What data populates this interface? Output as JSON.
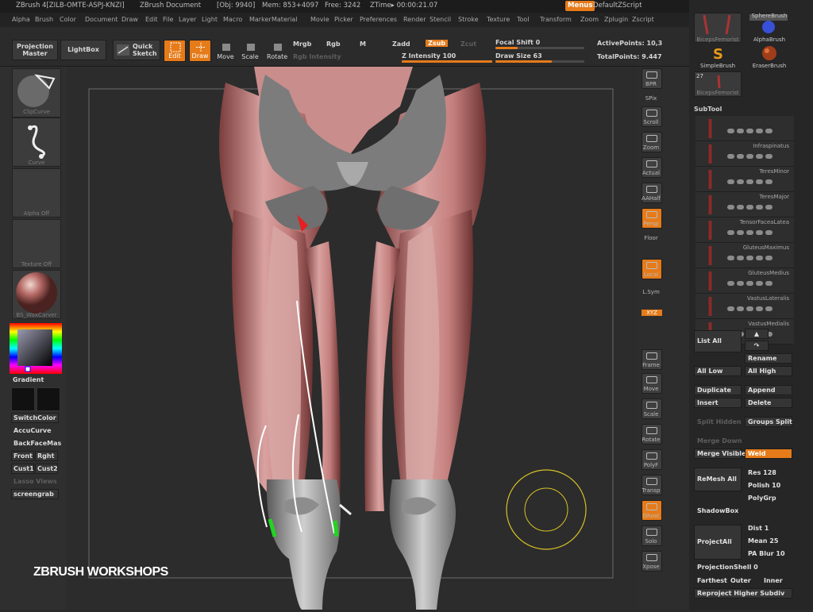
{
  "titlebar": {
    "app": "ZBrush 4[ZILB-OMTE-ASPJ-KNZI]",
    "doc": "ZBrush Document",
    "obj": "[Obj: 9940]",
    "mem": "Mem: 853+4097",
    "free": "Free: 3242",
    "ztime": "ZTime▸ 00:00:21.07",
    "menus_btn": "Menus",
    "script": "DefaultZScript"
  },
  "menubar": [
    "Alpha",
    "Brush",
    "Color",
    "Document",
    "Draw",
    "Edit",
    "File",
    "Layer",
    "Light",
    "Macro",
    "Marker",
    "Material",
    "Movie",
    "Picker",
    "Preferences",
    "Render",
    "Stencil",
    "Stroke",
    "Texture",
    "Tool",
    "Transform",
    "Zoom",
    "Zplugin",
    "Zscript"
  ],
  "toolbar": {
    "projection_master": "Projection Master",
    "lightbox": "LightBox",
    "quick_sketch": "Quick Sketch",
    "edit": "Edit",
    "draw": "Draw",
    "move": "Move",
    "scale": "Scale",
    "rotate": "Rotate",
    "mrgb": "Mrgb",
    "rgb": "Rgb",
    "m": "M",
    "rgb_intensity": "Rgb Intensity",
    "zadd": "Zadd",
    "zsub": "Zsub",
    "zcut": "Zcut",
    "z_intensity": "Z Intensity 100",
    "z_intensity_value": 100,
    "focal_shift": "Focal Shift 0",
    "focal_shift_value": 0,
    "draw_size": "Draw Size 63",
    "draw_size_value": 63,
    "active_points": "ActivePoints: 10,3",
    "total_points": "TotalPoints: 9.447"
  },
  "left": {
    "brush_name": "ClipCurve",
    "stroke_name": "Curve",
    "alpha_name": "Alpha  Off",
    "texture_name": "Texture  Off",
    "material_name": "BS_WaxCarver",
    "gradient": "Gradient",
    "switch_color": "SwitchColor",
    "accu_curve": "AccuCurve",
    "backface": "BackFaceMas",
    "front": "Front",
    "right": "Rght",
    "cust1": "Cust1",
    "cust2": "Cust2",
    "lasso_view": "Lasso Views",
    "screengrab": "screengrab"
  },
  "shelf": [
    "BPR",
    "SPix",
    "Scroll",
    "Zoom",
    "Actual",
    "AAHalf",
    "Persp",
    "Floor",
    "Local",
    "L.Sym",
    "XYZ",
    "Frame",
    "Move",
    "Scale",
    "Rotate",
    "PolyF",
    "Transp",
    "Ghost",
    "Solo",
    "Xpose"
  ],
  "right": {
    "brushes": [
      {
        "name": "BicepsFemorist",
        "num": ""
      },
      {
        "name": "SphereBrush",
        "num": ""
      },
      {
        "name": "AlphaBrush",
        "num": ""
      },
      {
        "name": "SimpleBrush",
        "num": ""
      },
      {
        "name": "EraserBrush",
        "num": ""
      },
      {
        "name": "BicepsFemorist",
        "num": "27"
      }
    ],
    "subtool_title": "SubTool",
    "subtools": [
      "",
      "Infraspinatus",
      "TeresMinor",
      "TeresMajor",
      "TensorFaceaLatea",
      "GluteusMaximus",
      "GluteusMedius",
      "VastusLateralis",
      "VastusMedialis"
    ],
    "list_all": "List All",
    "rename": "Rename",
    "all_low": "All Low",
    "all_high": "All High",
    "duplicate": "Duplicate",
    "append": "Append",
    "insert": "Insert",
    "delete": "Delete",
    "split_hidden": "Split Hidden",
    "groups_split": "Groups Split",
    "merge_down": "Merge Down",
    "merge_visible": "Merge Visible",
    "weld": "Weld",
    "remesh_all": "ReMesh All",
    "res": "Res 128",
    "polish": "Polish 10",
    "polygrp": "PolyGrp",
    "shadowbox": "ShadowBox",
    "project_all": "ProjectAll",
    "dist": "Dist 1",
    "mean": "Mean 25",
    "pa_blur": "PA Blur 10",
    "projection_shell": "ProjectionShell 0",
    "farthest": "Farthest",
    "outer": "Outer",
    "inner": "Inner",
    "reproject": "Reproject Higher Subdiv"
  },
  "watermark": "ZBRUSH WORKSHOPS"
}
